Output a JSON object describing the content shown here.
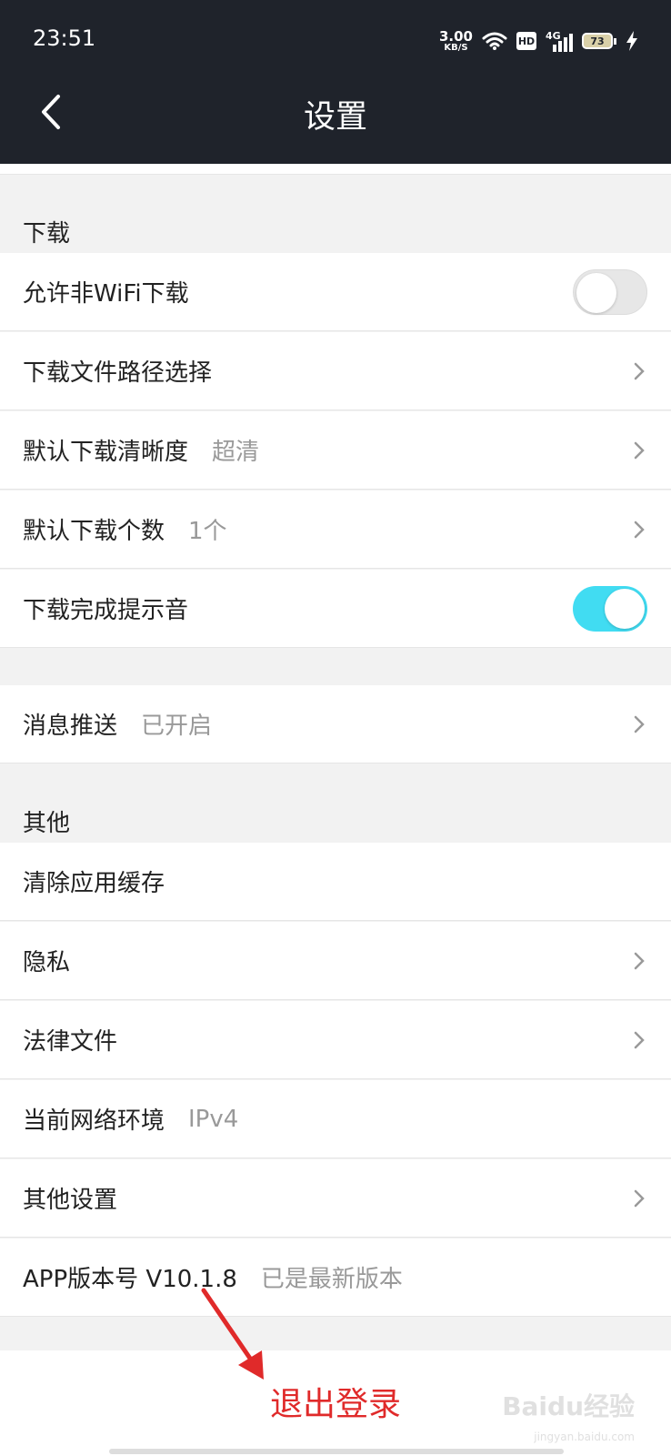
{
  "status_bar": {
    "time": "23:51",
    "speed_value": "3.00",
    "speed_unit": "KB/S",
    "hd_label": "HD",
    "network_label": "4G",
    "battery_level": "73"
  },
  "header": {
    "title": "设置"
  },
  "download_section": {
    "title": "下载",
    "allow_non_wifi": "允许非WiFi下载",
    "allow_non_wifi_on": false,
    "download_path": "下载文件路径选择",
    "default_quality_label": "默认下载清晰度",
    "default_quality_value": "超清",
    "default_count_label": "默认下载个数",
    "default_count_value": "1个",
    "completion_sound": "下载完成提示音",
    "completion_sound_on": true
  },
  "push_section": {
    "label": "消息推送",
    "value": "已开启"
  },
  "other_section": {
    "title": "其他",
    "clear_cache": "清除应用缓存",
    "privacy": "隐私",
    "legal_docs": "法律文件",
    "network_env_label": "当前网络环境",
    "network_env_value": "IPv4",
    "other_settings": "其他设置",
    "app_version_label": "APP版本号 V10.1.8",
    "app_version_status": "已是最新版本"
  },
  "logout": {
    "label": "退出登录"
  },
  "watermark": {
    "text": "Baidu经验",
    "sub": "jingyan.baidu.com"
  },
  "colors": {
    "header_bg": "#1f232b",
    "toggle_on": "#41dcf2",
    "logout_text": "#e02a2a",
    "annotation_arrow": "#e02a2a"
  }
}
